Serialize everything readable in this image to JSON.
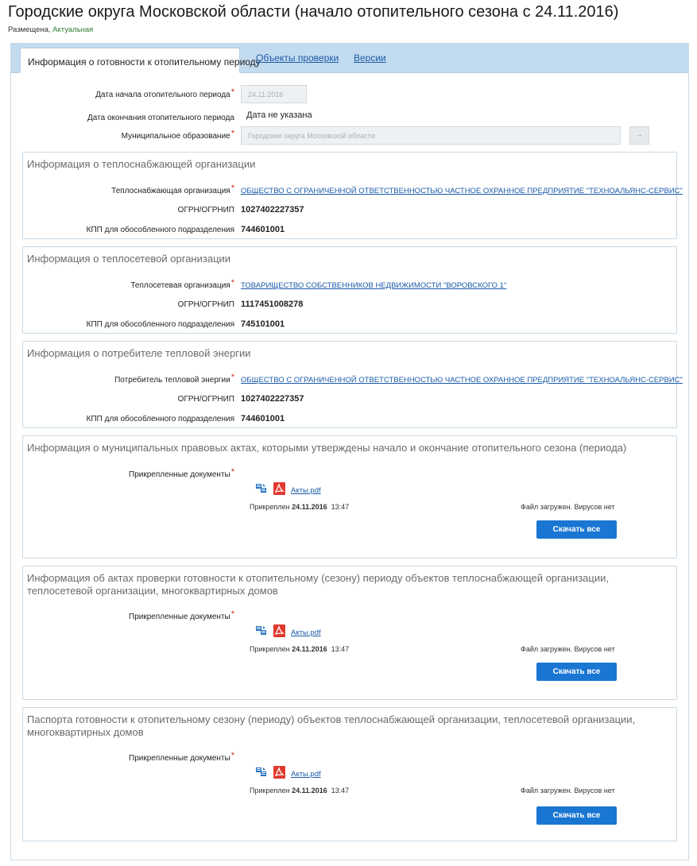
{
  "header": {
    "title": "Городские округа Московской области (начало отопительного сезона с 24.11.2016)",
    "status_placed": "Размещена,",
    "status_actual": "Актуальная"
  },
  "tabs": [
    {
      "label": "Информация о готовности к отопительному периоду",
      "active": true
    },
    {
      "label": "Объекты проверки",
      "active": false
    },
    {
      "label": "Версии",
      "active": false
    }
  ],
  "general": {
    "start_date_label": "Дата начала отопительного периода",
    "start_date_value": "24.11.2016",
    "end_date_label": "Дата окончания отопительного периода",
    "end_date_value": "Дата не указана",
    "municipality_label": "Муниципальное образование",
    "municipality_value": "Городские округа Московской области",
    "dots_label": ".."
  },
  "heat_supply": {
    "title": "Информация о теплоснабжающей организации",
    "org_label": "Теплоснабжающая организация",
    "org_value": "ОБЩЕСТВО С ОГРАНИЧЕННОЙ ОТВЕТСТВЕННОСТЬЮ ЧАСТНОЕ ОХРАННОЕ ПРЕДПРИЯТИЕ \"ТЕХНОАЛЬЯНС-СЕРВИС\"",
    "ogrn_label": "ОГРН/ОГРНИП",
    "ogrn_value": "1027402227357",
    "kpp_label": "КПП для обособленного подразделения",
    "kpp_value": "744601001"
  },
  "heat_network": {
    "title": "Информация о теплосетевой организации",
    "org_label": "Теплосетевая организация",
    "org_value": "ТОВАРИЩЕСТВО СОБСТВЕННИКОВ НЕДВИЖИМОСТИ \"ВОРОВСКОГО 1\"",
    "ogrn_label": "ОГРН/ОГРНИП",
    "ogrn_value": "1117451008278",
    "kpp_label": "КПП для обособленного подразделения",
    "kpp_value": "745101001"
  },
  "consumer": {
    "title": "Информация о потребителе тепловой энергии",
    "org_label": "Потребитель тепловой энергии",
    "org_value": "ОБЩЕСТВО С ОГРАНИЧЕННОЙ ОТВЕТСТВЕННОСТЬЮ ЧАСТНОЕ ОХРАННОЕ ПРЕДПРИЯТИЕ \"ТЕХНОАЛЬЯНС-СЕРВИС\"",
    "ogrn_label": "ОГРН/ОГРНИП",
    "ogrn_value": "1027402227357",
    "kpp_label": "КПП для обособленного подразделения",
    "kpp_value": "744601001"
  },
  "doc_sections": [
    {
      "title": "Информация о муниципальных правовых актах, которыми утверждены начало и окончание отопительного сезона (периода)",
      "attached_label": "Прикрепленные документы",
      "file_name": "Акты.pdf",
      "attached_prefix": "Прикреплен",
      "attached_date": "24.11.2016",
      "attached_time": "13:47",
      "file_status": "Файл загружен. Вирусов нет",
      "download_label": "Скачать все"
    },
    {
      "title": "Информация об актах проверки готовности к отопительному (сезону) периоду объектов теплоснабжающей организации, теплосетевой организации, многоквартирных домов",
      "attached_label": "Прикрепленные документы",
      "file_name": "Акты.pdf",
      "attached_prefix": "Прикреплен",
      "attached_date": "24.11.2016",
      "attached_time": "13:47",
      "file_status": "Файл загружен. Вирусов нет",
      "download_label": "Скачать все"
    },
    {
      "title": "Паспорта готовности к отопительному сезону (периоду) объектов теплоснабжающей организации, теплосетевой организации, многоквартирных домов",
      "attached_label": "Прикрепленные документы",
      "file_name": "Акты.pdf",
      "attached_prefix": "Прикреплен",
      "attached_date": "24.11.2016",
      "attached_time": "13:47",
      "file_status": "Файл загружен. Вирусов нет",
      "download_label": "Скачать все"
    }
  ],
  "colors": {
    "accent_blue": "#1976d2",
    "link_blue": "#1a5aa8",
    "tab_bar": "#c3dbef",
    "required_red": "#d12a2a",
    "actual_green": "#2c7d2c"
  }
}
